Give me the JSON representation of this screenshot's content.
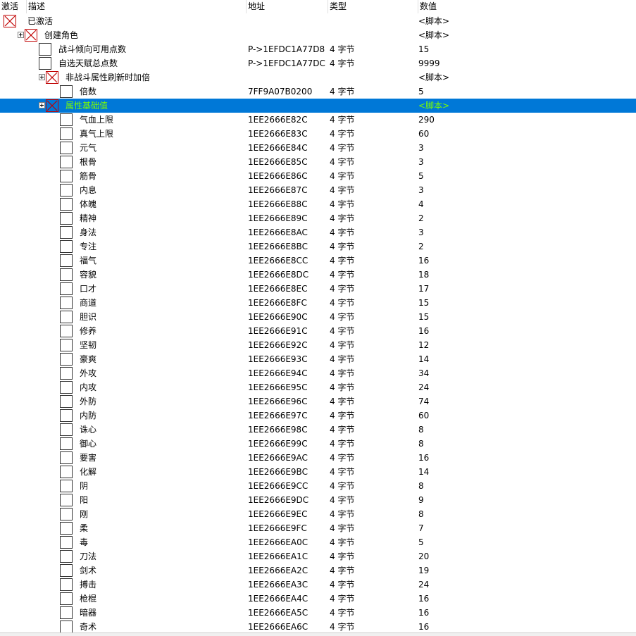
{
  "columns": {
    "active": "激活",
    "description": "描述",
    "address": "地址",
    "type": "类型",
    "value": "数值"
  },
  "colors": {
    "selected_bg": "#0078d7",
    "selected_text": "#7CFC00",
    "checked_mark": "#c00000"
  },
  "rows": [
    {
      "level": 0,
      "expander": false,
      "checked": true,
      "desc": "已激活",
      "addr": "",
      "type": "",
      "value": "<脚本>"
    },
    {
      "level": 1,
      "expander": true,
      "checked": true,
      "desc": "创建角色",
      "addr": "",
      "type": "",
      "value": "<脚本>"
    },
    {
      "level": 2,
      "expander": false,
      "checked": false,
      "desc": "战斗倾向可用点数",
      "addr": "P->1EFDC1A77D8",
      "type": "4 字节",
      "value": "15"
    },
    {
      "level": 2,
      "expander": false,
      "checked": false,
      "desc": "自选天赋总点数",
      "addr": "P->1EFDC1A77DC",
      "type": "4 字节",
      "value": "9999"
    },
    {
      "level": 2,
      "expander": true,
      "checked": true,
      "desc": "非战斗属性刷新时加倍",
      "addr": "",
      "type": "",
      "value": "<脚本>"
    },
    {
      "level": 3,
      "expander": false,
      "checked": false,
      "desc": "倍数",
      "addr": "7FF9A07B0200",
      "type": "4 字节",
      "value": "5"
    },
    {
      "level": 2,
      "expander": true,
      "checked": true,
      "selected": true,
      "desc": "属性基础值",
      "addr": "",
      "type": "",
      "value": "<脚本>"
    },
    {
      "level": 3,
      "expander": false,
      "checked": false,
      "desc": "气血上限",
      "addr": "1EE2666E82C",
      "type": "4 字节",
      "value": "290"
    },
    {
      "level": 3,
      "expander": false,
      "checked": false,
      "desc": "真气上限",
      "addr": "1EE2666E83C",
      "type": "4 字节",
      "value": "60"
    },
    {
      "level": 3,
      "expander": false,
      "checked": false,
      "desc": "元气",
      "addr": "1EE2666E84C",
      "type": "4 字节",
      "value": "3"
    },
    {
      "level": 3,
      "expander": false,
      "checked": false,
      "desc": "根骨",
      "addr": "1EE2666E85C",
      "type": "4 字节",
      "value": "3"
    },
    {
      "level": 3,
      "expander": false,
      "checked": false,
      "desc": "筋骨",
      "addr": "1EE2666E86C",
      "type": "4 字节",
      "value": "5"
    },
    {
      "level": 3,
      "expander": false,
      "checked": false,
      "desc": "内息",
      "addr": "1EE2666E87C",
      "type": "4 字节",
      "value": "3"
    },
    {
      "level": 3,
      "expander": false,
      "checked": false,
      "desc": "体魄",
      "addr": "1EE2666E88C",
      "type": "4 字节",
      "value": "4"
    },
    {
      "level": 3,
      "expander": false,
      "checked": false,
      "desc": "精神",
      "addr": "1EE2666E89C",
      "type": "4 字节",
      "value": "2"
    },
    {
      "level": 3,
      "expander": false,
      "checked": false,
      "desc": "身法",
      "addr": "1EE2666E8AC",
      "type": "4 字节",
      "value": "3"
    },
    {
      "level": 3,
      "expander": false,
      "checked": false,
      "desc": "专注",
      "addr": "1EE2666E8BC",
      "type": "4 字节",
      "value": "2"
    },
    {
      "level": 3,
      "expander": false,
      "checked": false,
      "desc": "福气",
      "addr": "1EE2666E8CC",
      "type": "4 字节",
      "value": "16"
    },
    {
      "level": 3,
      "expander": false,
      "checked": false,
      "desc": "容貌",
      "addr": "1EE2666E8DC",
      "type": "4 字节",
      "value": "18"
    },
    {
      "level": 3,
      "expander": false,
      "checked": false,
      "desc": "口才",
      "addr": "1EE2666E8EC",
      "type": "4 字节",
      "value": "17"
    },
    {
      "level": 3,
      "expander": false,
      "checked": false,
      "desc": "商道",
      "addr": "1EE2666E8FC",
      "type": "4 字节",
      "value": "15"
    },
    {
      "level": 3,
      "expander": false,
      "checked": false,
      "desc": "胆识",
      "addr": "1EE2666E90C",
      "type": "4 字节",
      "value": "15"
    },
    {
      "level": 3,
      "expander": false,
      "checked": false,
      "desc": "修养",
      "addr": "1EE2666E91C",
      "type": "4 字节",
      "value": "16"
    },
    {
      "level": 3,
      "expander": false,
      "checked": false,
      "desc": "坚韧",
      "addr": "1EE2666E92C",
      "type": "4 字节",
      "value": "12"
    },
    {
      "level": 3,
      "expander": false,
      "checked": false,
      "desc": "豪爽",
      "addr": "1EE2666E93C",
      "type": "4 字节",
      "value": "14"
    },
    {
      "level": 3,
      "expander": false,
      "checked": false,
      "desc": "外攻",
      "addr": "1EE2666E94C",
      "type": "4 字节",
      "value": "34"
    },
    {
      "level": 3,
      "expander": false,
      "checked": false,
      "desc": "内攻",
      "addr": "1EE2666E95C",
      "type": "4 字节",
      "value": "24"
    },
    {
      "level": 3,
      "expander": false,
      "checked": false,
      "desc": "外防",
      "addr": "1EE2666E96C",
      "type": "4 字节",
      "value": "74"
    },
    {
      "level": 3,
      "expander": false,
      "checked": false,
      "desc": "内防",
      "addr": "1EE2666E97C",
      "type": "4 字节",
      "value": "60"
    },
    {
      "level": 3,
      "expander": false,
      "checked": false,
      "desc": "诛心",
      "addr": "1EE2666E98C",
      "type": "4 字节",
      "value": "8"
    },
    {
      "level": 3,
      "expander": false,
      "checked": false,
      "desc": "御心",
      "addr": "1EE2666E99C",
      "type": "4 字节",
      "value": "8"
    },
    {
      "level": 3,
      "expander": false,
      "checked": false,
      "desc": "要害",
      "addr": "1EE2666E9AC",
      "type": "4 字节",
      "value": "16"
    },
    {
      "level": 3,
      "expander": false,
      "checked": false,
      "desc": "化解",
      "addr": "1EE2666E9BC",
      "type": "4 字节",
      "value": "14"
    },
    {
      "level": 3,
      "expander": false,
      "checked": false,
      "desc": "阴",
      "addr": "1EE2666E9CC",
      "type": "4 字节",
      "value": "8"
    },
    {
      "level": 3,
      "expander": false,
      "checked": false,
      "desc": "阳",
      "addr": "1EE2666E9DC",
      "type": "4 字节",
      "value": "9"
    },
    {
      "level": 3,
      "expander": false,
      "checked": false,
      "desc": "刚",
      "addr": "1EE2666E9EC",
      "type": "4 字节",
      "value": "8"
    },
    {
      "level": 3,
      "expander": false,
      "checked": false,
      "desc": "柔",
      "addr": "1EE2666E9FC",
      "type": "4 字节",
      "value": "7"
    },
    {
      "level": 3,
      "expander": false,
      "checked": false,
      "desc": "毒",
      "addr": "1EE2666EA0C",
      "type": "4 字节",
      "value": "5"
    },
    {
      "level": 3,
      "expander": false,
      "checked": false,
      "desc": "刀法",
      "addr": "1EE2666EA1C",
      "type": "4 字节",
      "value": "20"
    },
    {
      "level": 3,
      "expander": false,
      "checked": false,
      "desc": "剑术",
      "addr": "1EE2666EA2C",
      "type": "4 字节",
      "value": "19"
    },
    {
      "level": 3,
      "expander": false,
      "checked": false,
      "desc": "搏击",
      "addr": "1EE2666EA3C",
      "type": "4 字节",
      "value": "24"
    },
    {
      "level": 3,
      "expander": false,
      "checked": false,
      "desc": "枪棍",
      "addr": "1EE2666EA4C",
      "type": "4 字节",
      "value": "16"
    },
    {
      "level": 3,
      "expander": false,
      "checked": false,
      "desc": "暗器",
      "addr": "1EE2666EA5C",
      "type": "4 字节",
      "value": "16"
    },
    {
      "level": 3,
      "expander": false,
      "checked": false,
      "desc": "奇术",
      "addr": "1EE2666EA6C",
      "type": "4 字节",
      "value": "16"
    }
  ]
}
